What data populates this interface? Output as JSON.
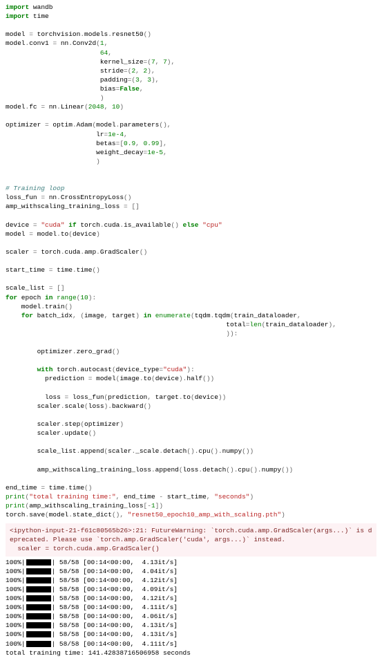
{
  "code_tokens": [
    [
      [
        "k",
        "import"
      ],
      [
        "nm",
        " wandb"
      ]
    ],
    [
      [
        "k",
        "import"
      ],
      [
        "nm",
        " time"
      ]
    ],
    [],
    [
      [
        "nm",
        "model "
      ],
      [
        "op",
        "="
      ],
      [
        "nm",
        " torchvision"
      ],
      [
        "op",
        "."
      ],
      [
        "nm",
        "models"
      ],
      [
        "op",
        "."
      ],
      [
        "nm",
        "resnet50"
      ],
      [
        "op",
        "()"
      ]
    ],
    [
      [
        "nm",
        "model"
      ],
      [
        "op",
        "."
      ],
      [
        "nm",
        "conv1 "
      ],
      [
        "op",
        "="
      ],
      [
        "nm",
        " nn"
      ],
      [
        "op",
        "."
      ],
      [
        "nm",
        "Conv2d"
      ],
      [
        "op",
        "("
      ],
      [
        "n",
        "1"
      ],
      [
        "op",
        ","
      ]
    ],
    [
      [
        "nm",
        "                        "
      ],
      [
        "n",
        "64"
      ],
      [
        "op",
        ","
      ]
    ],
    [
      [
        "nm",
        "                        kernel_size"
      ],
      [
        "op",
        "=("
      ],
      [
        "n",
        "7"
      ],
      [
        "op",
        ", "
      ],
      [
        "n",
        "7"
      ],
      [
        "op",
        "),"
      ]
    ],
    [
      [
        "nm",
        "                        stride"
      ],
      [
        "op",
        "=("
      ],
      [
        "n",
        "2"
      ],
      [
        "op",
        ", "
      ],
      [
        "n",
        "2"
      ],
      [
        "op",
        "),"
      ]
    ],
    [
      [
        "nm",
        "                        padding"
      ],
      [
        "op",
        "=("
      ],
      [
        "n",
        "3"
      ],
      [
        "op",
        ", "
      ],
      [
        "n",
        "3"
      ],
      [
        "op",
        "),"
      ]
    ],
    [
      [
        "nm",
        "                        bias"
      ],
      [
        "op",
        "="
      ],
      [
        "bc",
        "False"
      ],
      [
        "op",
        ","
      ]
    ],
    [
      [
        "nm",
        "                        "
      ],
      [
        "op",
        ")"
      ]
    ],
    [
      [
        "nm",
        "model"
      ],
      [
        "op",
        "."
      ],
      [
        "nm",
        "fc "
      ],
      [
        "op",
        "="
      ],
      [
        "nm",
        " nn"
      ],
      [
        "op",
        "."
      ],
      [
        "nm",
        "Linear"
      ],
      [
        "op",
        "("
      ],
      [
        "n",
        "2048"
      ],
      [
        "op",
        ", "
      ],
      [
        "n",
        "10"
      ],
      [
        "op",
        ")"
      ]
    ],
    [],
    [
      [
        "nm",
        "optimizer "
      ],
      [
        "op",
        "="
      ],
      [
        "nm",
        " optim"
      ],
      [
        "op",
        "."
      ],
      [
        "nm",
        "Adam"
      ],
      [
        "op",
        "("
      ],
      [
        "nm",
        "model"
      ],
      [
        "op",
        "."
      ],
      [
        "nm",
        "parameters"
      ],
      [
        "op",
        "(),"
      ]
    ],
    [
      [
        "nm",
        "                       lr"
      ],
      [
        "op",
        "="
      ],
      [
        "n",
        "1e-4"
      ],
      [
        "op",
        ","
      ]
    ],
    [
      [
        "nm",
        "                       betas"
      ],
      [
        "op",
        "=["
      ],
      [
        "n",
        "0.9"
      ],
      [
        "op",
        ", "
      ],
      [
        "n",
        "0.99"
      ],
      [
        "op",
        "],"
      ]
    ],
    [
      [
        "nm",
        "                       weight_decay"
      ],
      [
        "op",
        "="
      ],
      [
        "n",
        "1e-5"
      ],
      [
        "op",
        ","
      ]
    ],
    [
      [
        "nm",
        "                       "
      ],
      [
        "op",
        ")"
      ]
    ],
    [],
    [],
    [
      [
        "c",
        "# Training loop"
      ]
    ],
    [
      [
        "nm",
        "loss_fun "
      ],
      [
        "op",
        "="
      ],
      [
        "nm",
        " nn"
      ],
      [
        "op",
        "."
      ],
      [
        "nm",
        "CrossEntropyLoss"
      ],
      [
        "op",
        "()"
      ]
    ],
    [
      [
        "nm",
        "amp_withscaling_training_loss "
      ],
      [
        "op",
        "="
      ],
      [
        "nm",
        " "
      ],
      [
        "op",
        "[]"
      ]
    ],
    [],
    [
      [
        "nm",
        "device "
      ],
      [
        "op",
        "="
      ],
      [
        "nm",
        " "
      ],
      [
        "s",
        "\"cuda\""
      ],
      [
        "nm",
        " "
      ],
      [
        "k",
        "if"
      ],
      [
        "nm",
        " torch"
      ],
      [
        "op",
        "."
      ],
      [
        "nm",
        "cuda"
      ],
      [
        "op",
        "."
      ],
      [
        "nm",
        "is_available"
      ],
      [
        "op",
        "()"
      ],
      [
        "nm",
        " "
      ],
      [
        "k",
        "else"
      ],
      [
        "nm",
        " "
      ],
      [
        "s",
        "\"cpu\""
      ]
    ],
    [
      [
        "nm",
        "model "
      ],
      [
        "op",
        "="
      ],
      [
        "nm",
        " model"
      ],
      [
        "op",
        "."
      ],
      [
        "nm",
        "to"
      ],
      [
        "op",
        "("
      ],
      [
        "nm",
        "device"
      ],
      [
        "op",
        ")"
      ]
    ],
    [],
    [
      [
        "nm",
        "scaler "
      ],
      [
        "op",
        "="
      ],
      [
        "nm",
        " torch"
      ],
      [
        "op",
        "."
      ],
      [
        "nm",
        "cuda"
      ],
      [
        "op",
        "."
      ],
      [
        "nm",
        "amp"
      ],
      [
        "op",
        "."
      ],
      [
        "nm",
        "GradScaler"
      ],
      [
        "op",
        "()"
      ]
    ],
    [],
    [
      [
        "nm",
        "start_time "
      ],
      [
        "op",
        "="
      ],
      [
        "nm",
        " time"
      ],
      [
        "op",
        "."
      ],
      [
        "nm",
        "time"
      ],
      [
        "op",
        "()"
      ]
    ],
    [],
    [
      [
        "nm",
        "scale_list "
      ],
      [
        "op",
        "="
      ],
      [
        "nm",
        " "
      ],
      [
        "op",
        "[]"
      ]
    ],
    [
      [
        "k",
        "for"
      ],
      [
        "nm",
        " epoch "
      ],
      [
        "k",
        "in"
      ],
      [
        "nm",
        " "
      ],
      [
        "bi",
        "range"
      ],
      [
        "op",
        "("
      ],
      [
        "n",
        "10"
      ],
      [
        "op",
        "):"
      ]
    ],
    [
      [
        "nm",
        "    model"
      ],
      [
        "op",
        "."
      ],
      [
        "nm",
        "train"
      ],
      [
        "op",
        "()"
      ]
    ],
    [
      [
        "nm",
        "    "
      ],
      [
        "k",
        "for"
      ],
      [
        "nm",
        " batch_idx"
      ],
      [
        "op",
        ","
      ],
      [
        "nm",
        " "
      ],
      [
        "op",
        "("
      ],
      [
        "nm",
        "image"
      ],
      [
        "op",
        ","
      ],
      [
        "nm",
        " target"
      ],
      [
        "op",
        ")"
      ],
      [
        "nm",
        " "
      ],
      [
        "k",
        "in"
      ],
      [
        "nm",
        " "
      ],
      [
        "bi",
        "enumerate"
      ],
      [
        "op",
        "("
      ],
      [
        "nm",
        "tqdm"
      ],
      [
        "op",
        "."
      ],
      [
        "nm",
        "tqdm"
      ],
      [
        "op",
        "("
      ],
      [
        "nm",
        "train_dataloader"
      ],
      [
        "op",
        ","
      ]
    ],
    [
      [
        "nm",
        "                                                        total"
      ],
      [
        "op",
        "="
      ],
      [
        "bi",
        "len"
      ],
      [
        "op",
        "("
      ],
      [
        "nm",
        "train_dataloader"
      ],
      [
        "op",
        "),"
      ]
    ],
    [
      [
        "nm",
        "                                                        "
      ],
      [
        "op",
        "))"
      ],
      [
        "op",
        ":"
      ]
    ],
    [],
    [
      [
        "nm",
        "        optimizer"
      ],
      [
        "op",
        "."
      ],
      [
        "nm",
        "zero_grad"
      ],
      [
        "op",
        "()"
      ]
    ],
    [],
    [
      [
        "nm",
        "        "
      ],
      [
        "k",
        "with"
      ],
      [
        "nm",
        " torch"
      ],
      [
        "op",
        "."
      ],
      [
        "nm",
        "autocast"
      ],
      [
        "op",
        "("
      ],
      [
        "nm",
        "device_type"
      ],
      [
        "op",
        "="
      ],
      [
        "s",
        "\"cuda\""
      ],
      [
        "op",
        "):"
      ]
    ],
    [
      [
        "nm",
        "          prediction "
      ],
      [
        "op",
        "="
      ],
      [
        "nm",
        " model"
      ],
      [
        "op",
        "("
      ],
      [
        "nm",
        "image"
      ],
      [
        "op",
        "."
      ],
      [
        "nm",
        "to"
      ],
      [
        "op",
        "("
      ],
      [
        "nm",
        "device"
      ],
      [
        "op",
        ")"
      ],
      [
        "op",
        "."
      ],
      [
        "nm",
        "half"
      ],
      [
        "op",
        "())"
      ]
    ],
    [],
    [
      [
        "nm",
        "          loss "
      ],
      [
        "op",
        "="
      ],
      [
        "nm",
        " loss_fun"
      ],
      [
        "op",
        "("
      ],
      [
        "nm",
        "prediction"
      ],
      [
        "op",
        ","
      ],
      [
        "nm",
        " target"
      ],
      [
        "op",
        "."
      ],
      [
        "nm",
        "to"
      ],
      [
        "op",
        "("
      ],
      [
        "nm",
        "device"
      ],
      [
        "op",
        "))"
      ]
    ],
    [
      [
        "nm",
        "        scaler"
      ],
      [
        "op",
        "."
      ],
      [
        "nm",
        "scale"
      ],
      [
        "op",
        "("
      ],
      [
        "nm",
        "loss"
      ],
      [
        "op",
        ")"
      ],
      [
        "op",
        "."
      ],
      [
        "nm",
        "backward"
      ],
      [
        "op",
        "()"
      ]
    ],
    [],
    [
      [
        "nm",
        "        scaler"
      ],
      [
        "op",
        "."
      ],
      [
        "nm",
        "step"
      ],
      [
        "op",
        "("
      ],
      [
        "nm",
        "optimizer"
      ],
      [
        "op",
        ")"
      ]
    ],
    [
      [
        "nm",
        "        scaler"
      ],
      [
        "op",
        "."
      ],
      [
        "nm",
        "update"
      ],
      [
        "op",
        "()"
      ]
    ],
    [],
    [
      [
        "nm",
        "        scale_list"
      ],
      [
        "op",
        "."
      ],
      [
        "nm",
        "append"
      ],
      [
        "op",
        "("
      ],
      [
        "nm",
        "scaler"
      ],
      [
        "op",
        "."
      ],
      [
        "nm",
        "_scale"
      ],
      [
        "op",
        "."
      ],
      [
        "nm",
        "detach"
      ],
      [
        "op",
        "()"
      ],
      [
        "op",
        "."
      ],
      [
        "nm",
        "cpu"
      ],
      [
        "op",
        "()"
      ],
      [
        "op",
        "."
      ],
      [
        "nm",
        "numpy"
      ],
      [
        "op",
        "())"
      ]
    ],
    [],
    [
      [
        "nm",
        "        amp_withscaling_training_loss"
      ],
      [
        "op",
        "."
      ],
      [
        "nm",
        "append"
      ],
      [
        "op",
        "("
      ],
      [
        "nm",
        "loss"
      ],
      [
        "op",
        "."
      ],
      [
        "nm",
        "detach"
      ],
      [
        "op",
        "()"
      ],
      [
        "op",
        "."
      ],
      [
        "nm",
        "cpu"
      ],
      [
        "op",
        "()"
      ],
      [
        "op",
        "."
      ],
      [
        "nm",
        "numpy"
      ],
      [
        "op",
        "())"
      ]
    ],
    [],
    [
      [
        "nm",
        "end_time "
      ],
      [
        "op",
        "="
      ],
      [
        "nm",
        " time"
      ],
      [
        "op",
        "."
      ],
      [
        "nm",
        "time"
      ],
      [
        "op",
        "()"
      ]
    ],
    [
      [
        "bi",
        "print"
      ],
      [
        "op",
        "("
      ],
      [
        "s",
        "\"total training time:\""
      ],
      [
        "op",
        ","
      ],
      [
        "nm",
        " end_time "
      ],
      [
        "op",
        "-"
      ],
      [
        "nm",
        " start_time"
      ],
      [
        "op",
        ","
      ],
      [
        "nm",
        " "
      ],
      [
        "s",
        "\"seconds\""
      ],
      [
        "op",
        ")"
      ]
    ],
    [
      [
        "bi",
        "print"
      ],
      [
        "op",
        "("
      ],
      [
        "nm",
        "amp_withscaling_training_loss"
      ],
      [
        "op",
        "[-"
      ],
      [
        "n",
        "1"
      ],
      [
        "op",
        "])"
      ]
    ],
    [
      [
        "nm",
        "torch"
      ],
      [
        "op",
        "."
      ],
      [
        "nm",
        "save"
      ],
      [
        "op",
        "("
      ],
      [
        "nm",
        "model"
      ],
      [
        "op",
        "."
      ],
      [
        "nm",
        "state_dict"
      ],
      [
        "op",
        "(),"
      ],
      [
        "nm",
        " "
      ],
      [
        "s",
        "\"resnet50_epoch10_amp_with_scaling.pth\""
      ],
      [
        "op",
        ")"
      ]
    ]
  ],
  "warning_text": "<ipython-input-21-f61c80565b26>:21: FutureWarning: `torch.cuda.amp.GradScaler(args...)` is deprecated. Please use `torch.amp.GradScaler('cuda', args...)` instead.\n  scaler = torch.cuda.amp.GradScaler()",
  "progress_lines": [
    {
      "pct": "100%",
      "count": "58/58",
      "time": "[00:14<00:00,",
      "rate": "4.13it/s]"
    },
    {
      "pct": "100%",
      "count": "58/58",
      "time": "[00:14<00:00,",
      "rate": "4.04it/s]"
    },
    {
      "pct": "100%",
      "count": "58/58",
      "time": "[00:14<00:00,",
      "rate": "4.12it/s]"
    },
    {
      "pct": "100%",
      "count": "58/58",
      "time": "[00:14<00:00,",
      "rate": "4.09it/s]"
    },
    {
      "pct": "100%",
      "count": "58/58",
      "time": "[00:14<00:00,",
      "rate": "4.12it/s]"
    },
    {
      "pct": "100%",
      "count": "58/58",
      "time": "[00:14<00:00,",
      "rate": "4.11it/s]"
    },
    {
      "pct": "100%",
      "count": "58/58",
      "time": "[00:14<00:00,",
      "rate": "4.06it/s]"
    },
    {
      "pct": "100%",
      "count": "58/58",
      "time": "[00:14<00:00,",
      "rate": "4.13it/s]"
    },
    {
      "pct": "100%",
      "count": "58/58",
      "time": "[00:14<00:00,",
      "rate": "4.13it/s]"
    },
    {
      "pct": "100%",
      "count": "58/58",
      "time": "[00:14<00:00,",
      "rate": "4.11it/s]"
    }
  ],
  "final_line": "total training time: 141.42838716506958 seconds"
}
